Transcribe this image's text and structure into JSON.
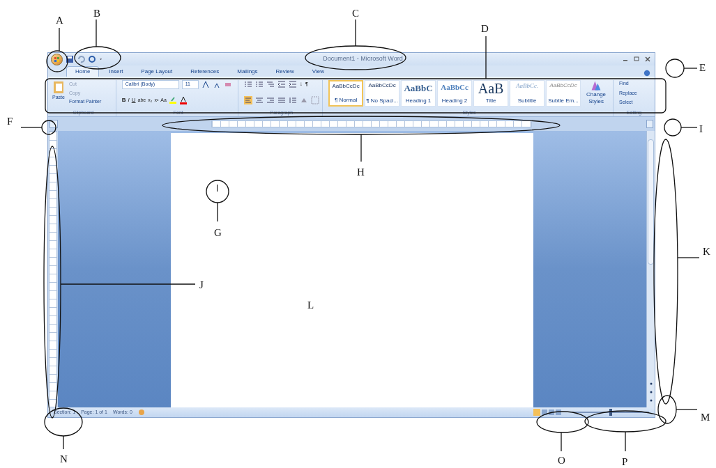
{
  "window": {
    "title": "Document1 - Microsoft Word"
  },
  "tabs": [
    {
      "label": "Home",
      "selected": true
    },
    {
      "label": "Insert",
      "selected": false
    },
    {
      "label": "Page Layout",
      "selected": false
    },
    {
      "label": "References",
      "selected": false
    },
    {
      "label": "Mailings",
      "selected": false
    },
    {
      "label": "Review",
      "selected": false
    },
    {
      "label": "View",
      "selected": false
    }
  ],
  "clipboard": {
    "label": "Clipboard",
    "paste": "Paste",
    "cut": "Cut",
    "copy": "Copy",
    "format_painter": "Format Painter"
  },
  "font": {
    "label": "Font",
    "family": "Calibri (Body)",
    "size": "11",
    "buttons": [
      "B",
      "I",
      "U",
      "abe",
      "x₂",
      "x²",
      "Aa"
    ]
  },
  "paragraph": {
    "label": "Paragraph",
    "sort": "↓",
    "marks": "¶"
  },
  "styles": {
    "label": "Styles",
    "items": [
      {
        "sample": "AaBbCcDc",
        "name": "¶ Normal",
        "selected": true,
        "kind": "normal"
      },
      {
        "sample": "AaBbCcDc",
        "name": "¶ No Spaci...",
        "selected": false,
        "kind": "normal"
      },
      {
        "sample": "AaBbC",
        "name": "Heading 1",
        "selected": false,
        "kind": "heading"
      },
      {
        "sample": "AaBbCc",
        "name": "Heading 2",
        "selected": false,
        "kind": "heading2"
      },
      {
        "sample": "AaB",
        "name": "Title",
        "selected": false,
        "kind": "title"
      },
      {
        "sample": "AaBbCc.",
        "name": "Subtitle",
        "selected": false,
        "kind": "subtitle"
      },
      {
        "sample": "AaBbCcDc",
        "name": "Subtle Em...",
        "selected": false,
        "kind": "subtle"
      }
    ],
    "change_styles": "Change Styles"
  },
  "editing": {
    "label": "Editing",
    "find": "Find",
    "replace": "Replace",
    "select": "Select"
  },
  "status_bar": {
    "section": "Section: 1",
    "page": "Page: 1 of 1",
    "words": "Words: 0",
    "zoom": {
      "level": 0.5
    }
  },
  "annotations": [
    {
      "label": "A"
    },
    {
      "label": "B"
    },
    {
      "label": "C"
    },
    {
      "label": "D"
    },
    {
      "label": "E"
    },
    {
      "label": "F"
    },
    {
      "label": "G"
    },
    {
      "label": "H"
    },
    {
      "label": "I"
    },
    {
      "label": "J"
    },
    {
      "label": "K"
    },
    {
      "label": "L"
    },
    {
      "label": "M"
    },
    {
      "label": "N"
    },
    {
      "label": "O"
    },
    {
      "label": "P"
    }
  ]
}
